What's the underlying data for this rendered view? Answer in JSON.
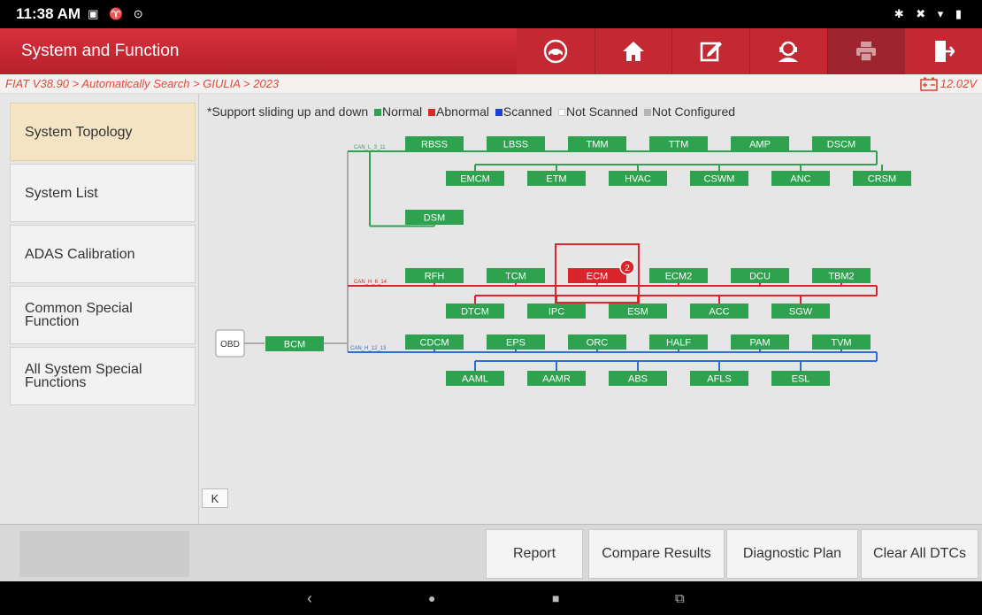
{
  "status": {
    "time": "11:38 AM",
    "left_icons": "▣ ♈ ⊙",
    "right_icons": "✱ ✖ ▾ ▮"
  },
  "header": {
    "title": "System and Function"
  },
  "toolbar": {
    "icons": [
      "car-diagnostic-icon",
      "home-icon",
      "edit-icon",
      "support-agent-icon",
      "print-icon",
      "exit-icon"
    ],
    "disabled": [
      "print-icon"
    ]
  },
  "breadcrumb": {
    "path": "FIAT V38.90 > Automatically Search > GIULIA > 2023",
    "voltage": "12.02V"
  },
  "sidebar": {
    "items": [
      {
        "label": "System Topology",
        "active": true
      },
      {
        "label": "System List",
        "active": false
      },
      {
        "label": "ADAS Calibration",
        "active": false
      },
      {
        "label": "Common Special Function",
        "active": false
      },
      {
        "label": "All System Special Functions",
        "active": false
      }
    ]
  },
  "legend": {
    "hint": "*Support sliding up and down",
    "items": [
      {
        "label": "Normal",
        "color": "#2ea24e"
      },
      {
        "label": "Abnormal",
        "color": "#d9252b"
      },
      {
        "label": "Scanned",
        "color": "#1c3fd6"
      },
      {
        "label": "Not Scanned",
        "color": "#ffffff"
      },
      {
        "label": "Not Configured",
        "color": "#b4b4b4"
      }
    ]
  },
  "topology": {
    "obd": "OBD",
    "gateway": "BCM",
    "buses": [
      {
        "name": "CAN_L_3_11",
        "color": "#2ea24e",
        "top": [
          "RBSS",
          "LBSS",
          "TMM",
          "TTM",
          "AMP",
          "DSCM"
        ],
        "bottom": [
          "EMCM",
          "ETM",
          "HVAC",
          "CSWM",
          "ANC",
          "CRSM"
        ],
        "extra": [
          "DSM"
        ]
      },
      {
        "name": "CAN_H_6_14",
        "color": "#d9252b",
        "top": [
          "RFH",
          "TCM",
          "ECM",
          "ECM2",
          "DCU",
          "TBM2"
        ],
        "bottom": [
          "DTCM",
          "IPC",
          "ESM",
          "ACC",
          "SGW"
        ],
        "fault": {
          "module": "ECM",
          "dtc_count": "2"
        }
      },
      {
        "name": "CAN_H_12_13",
        "color": "#2c6fd1",
        "top": [
          "CDCM",
          "EPS",
          "ORC",
          "HALF",
          "PAM",
          "TVM"
        ],
        "bottom": [
          "AAML",
          "AAMR",
          "ABS",
          "AFLS",
          "ESL"
        ]
      }
    ]
  },
  "collapse_button": {
    "label": "K"
  },
  "footer": {
    "buttons": [
      "Report",
      "Compare Results",
      "Diagnostic Plan",
      "Clear All DTCs"
    ]
  },
  "android_nav": {
    "back": "‹",
    "home": "●",
    "recents": "■",
    "screenshot": "⧉"
  }
}
